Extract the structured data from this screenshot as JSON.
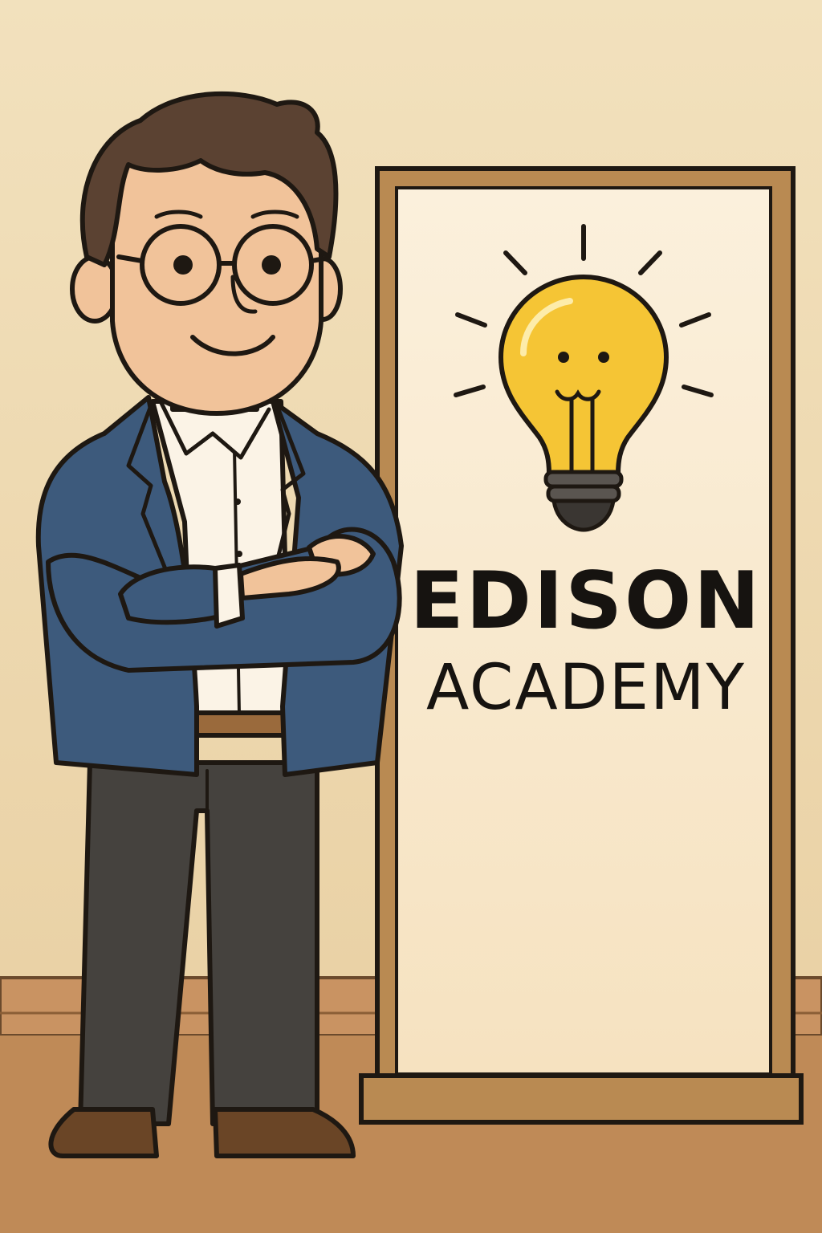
{
  "banner": {
    "line1": "EDISON",
    "line2": "ACADEMY"
  },
  "colors": {
    "wall": "#efdcb6",
    "floor": "#c08a56",
    "banner_face": "#fbecd2",
    "banner_frame": "#b98a52",
    "bulb": "#f5c535",
    "jacket": "#3d5a7c",
    "pants": "#45423e",
    "outline": "#1e1812"
  },
  "icons": [
    "lightbulb-icon",
    "person-illustration",
    "roll-up-banner"
  ]
}
